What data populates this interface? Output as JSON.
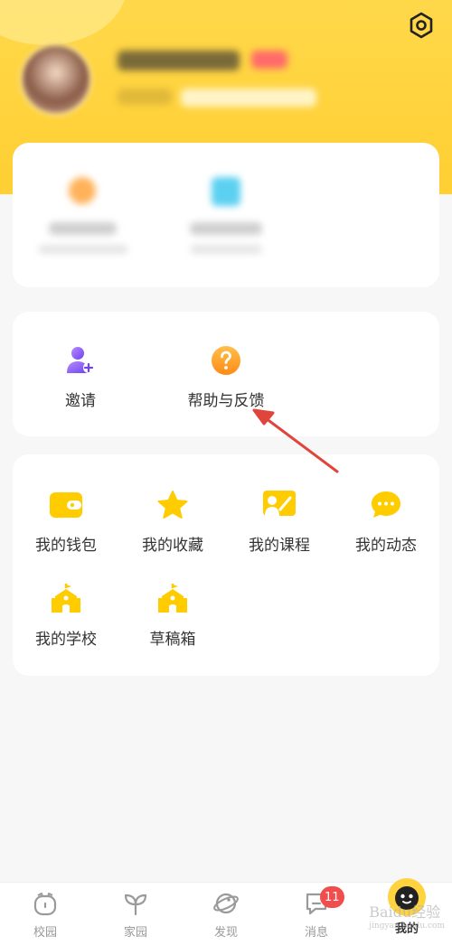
{
  "colors": {
    "brand_yellow": "#ffd23f",
    "icon_yellow": "#ffcc00",
    "invite_purple": "#8a5cf5",
    "help_orange": "#ff9a1f",
    "arrow_red": "#e0453c",
    "badge_red": "#f24d4d"
  },
  "header": {
    "settings_icon": "hexagon-settings-icon"
  },
  "service_card": {
    "items": [
      {
        "label": "邀请",
        "icon": "invite-user-icon"
      },
      {
        "label": "帮助与反馈",
        "icon": "help-question-icon"
      }
    ]
  },
  "menu_card": {
    "items": [
      {
        "label": "我的钱包",
        "icon": "wallet-icon"
      },
      {
        "label": "我的收藏",
        "icon": "star-icon"
      },
      {
        "label": "我的课程",
        "icon": "course-icon"
      },
      {
        "label": "我的动态",
        "icon": "chat-bubble-icon"
      },
      {
        "label": "我的学校",
        "icon": "school-icon"
      },
      {
        "label": "草稿箱",
        "icon": "drafts-icon"
      }
    ]
  },
  "tabbar": {
    "tabs": [
      {
        "label": "校园",
        "icon": "campus-icon"
      },
      {
        "label": "家园",
        "icon": "sprout-icon"
      },
      {
        "label": "发现",
        "icon": "planet-icon"
      },
      {
        "label": "消息",
        "icon": "message-icon",
        "badge": "11"
      },
      {
        "label": "我的",
        "icon": "me-face-icon",
        "active": true
      }
    ]
  },
  "watermark": {
    "text": "Baidu经验",
    "subtext": "jingyan.baidu.com"
  }
}
